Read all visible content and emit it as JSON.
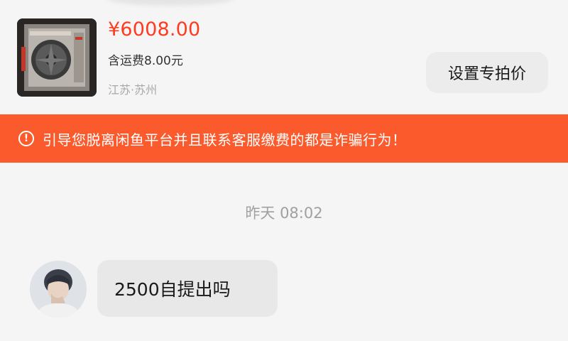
{
  "product": {
    "price": "¥6008.00",
    "shipping": "含运费8.00元",
    "location": "江苏·苏州",
    "set_price_button": "设置专拍价"
  },
  "banner": {
    "icon": "warning-circle-icon",
    "text": "引导您脱离闲鱼平台并且联系客服缴费的都是诈骗行为！"
  },
  "chat": {
    "timestamp": "昨天 08:02",
    "messages": [
      {
        "direction": "incoming",
        "text": "2500自提出吗"
      }
    ]
  },
  "colors": {
    "price_red": "#ff3b1f",
    "banner_orange": "#fb5a2c",
    "background": "#f5f5f5",
    "bubble": "#e8e8e8"
  }
}
